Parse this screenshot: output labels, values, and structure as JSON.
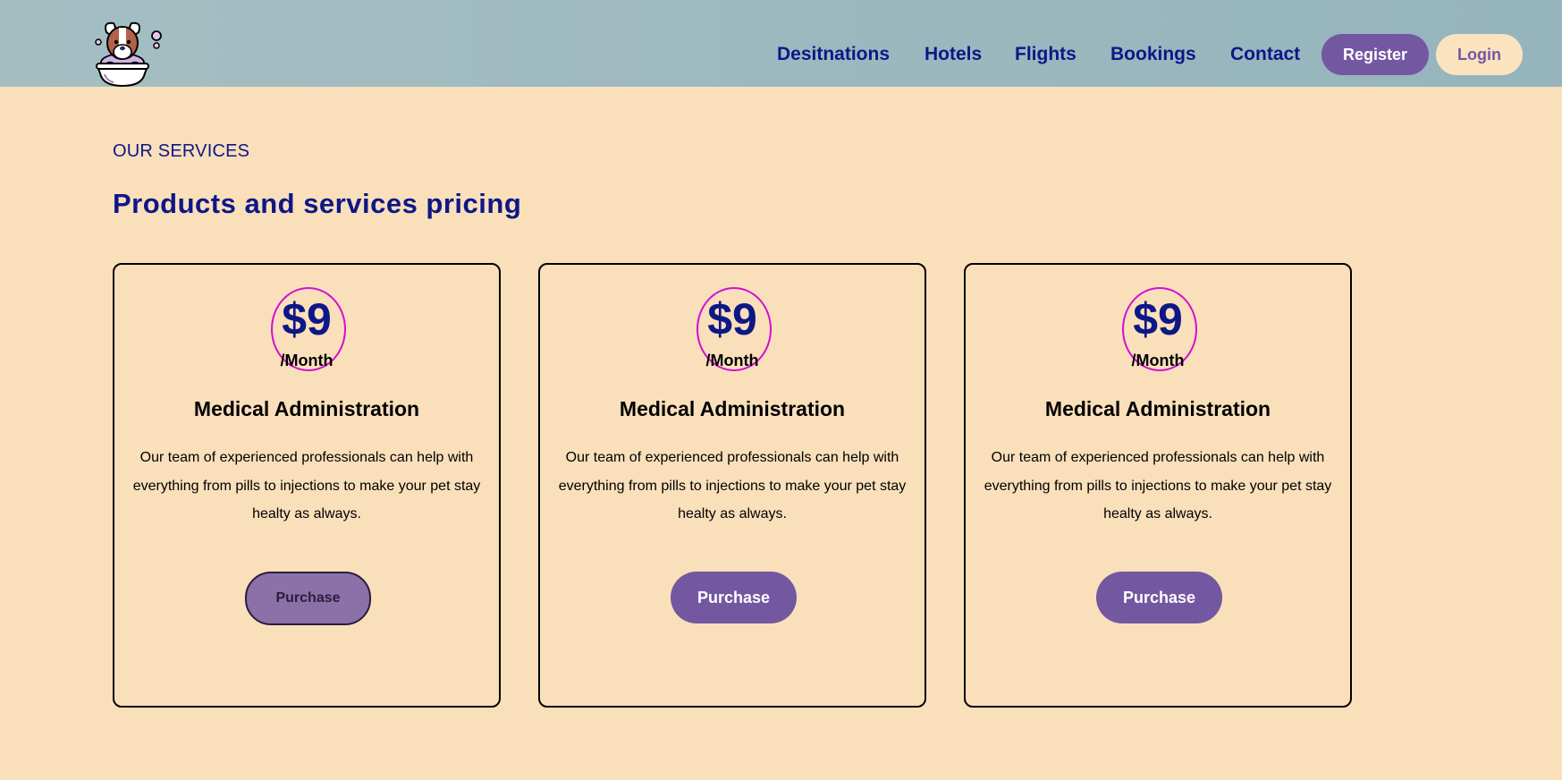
{
  "header": {
    "logo_icon": "dog-in-bathtub-logo-icon",
    "nav": [
      "Desitnations",
      "Hotels",
      "Flights",
      "Bookings",
      "Contact"
    ],
    "register_label": "Register",
    "login_label": "Login"
  },
  "section": {
    "eyebrow": "OUR SERVICES",
    "title": "Products and services pricing"
  },
  "cards": [
    {
      "price": "$9",
      "period": "/Month",
      "title": "Medical Administration",
      "description": "Our team of experienced professionals can help with everything from pills to injections to make your pet stay healty as always.",
      "button": "Purchase"
    },
    {
      "price": "$9",
      "period": "/Month",
      "title": "Medical Administration",
      "description": "Our team of experienced professionals can help with everything from pills to injections to make your pet stay healty as always.",
      "button": "Purchase"
    },
    {
      "price": "$9",
      "period": "/Month",
      "title": "Medical Administration",
      "description": "Our team of experienced professionals can help with everything from pills to injections to make your pet stay healty as always.",
      "button": "Purchase"
    }
  ],
  "colors": {
    "page_background": "#fadfbb",
    "header_background": "#9cb9bf",
    "primary_text": "#0d1787",
    "accent": "#7457a1",
    "price_ring": "#d20fd2"
  }
}
